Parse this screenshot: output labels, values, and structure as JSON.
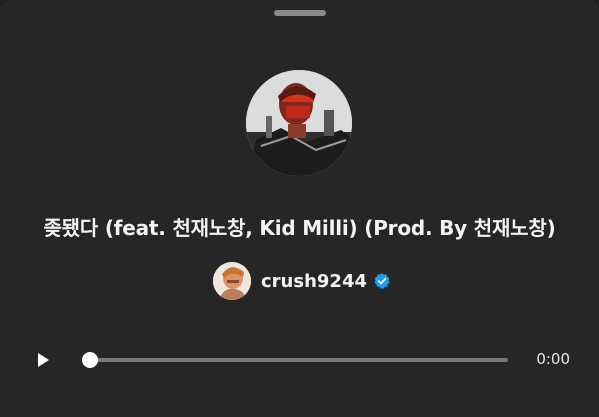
{
  "track": {
    "title": "좆됐다 (feat. 천재노창, Kid Milli) (Prod. By 천재노창)",
    "cover_icon": "album-cover-image"
  },
  "artist": {
    "username": "crush9244",
    "verified": true,
    "verified_color": "#1d9bf0",
    "avatar_icon": "artist-avatar-image"
  },
  "player": {
    "current_time": "0:00",
    "progress": 0,
    "play_icon": "play-icon"
  },
  "colors": {
    "background": "#262626",
    "text": "#f2f2f2",
    "track": "#7a7a7a"
  }
}
